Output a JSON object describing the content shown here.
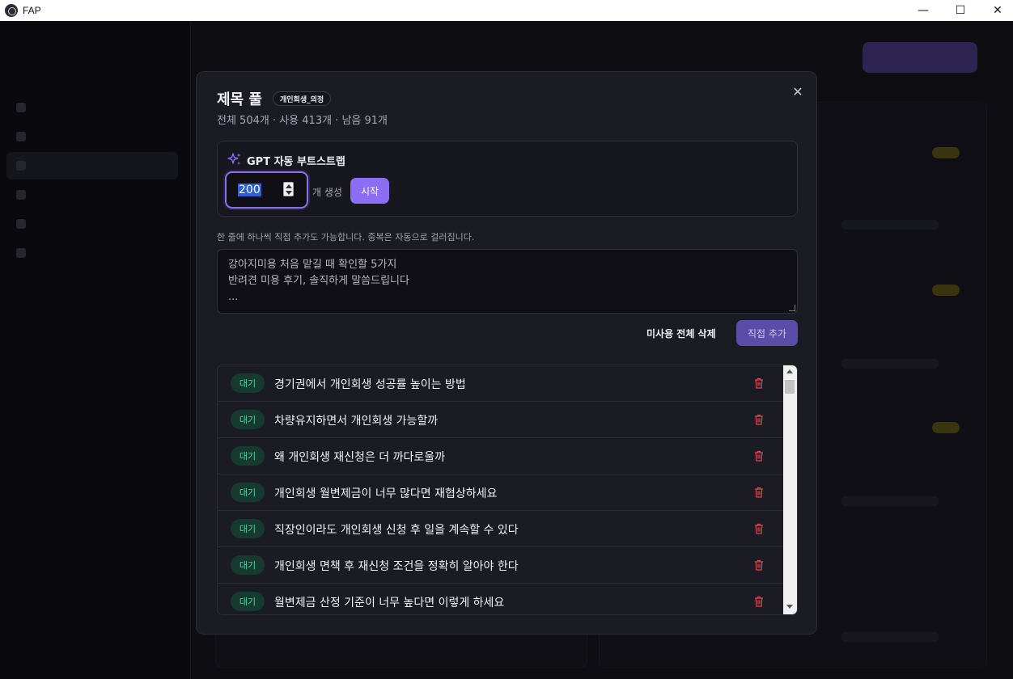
{
  "window": {
    "title": "FAP",
    "minimize": "—",
    "maximize": "☐",
    "close": "✕"
  },
  "modal": {
    "title": "제목 풀",
    "badge": "개인회생_의정",
    "stats": "전체 504개 · 사용 413개 · 남음 91개",
    "close_icon": "✕",
    "gpt": {
      "icon": "sparkles-icon",
      "title": "GPT 자동 부트스트랩",
      "count_value": "200",
      "count_unit": "개 생성",
      "start_label": "시작"
    },
    "helper_text": "한 줄에 하나씩 직접 추가도 가능합니다. 중복은 자동으로 걸러집니다.",
    "textarea_placeholder_lines": [
      "강아지미용 처음 맡길 때 확인할 5가지",
      "반려견 미용 후기, 솔직하게 말씀드립니다",
      "..."
    ],
    "delete_unused_label": "미사용 전체 삭제",
    "add_direct_label": "직접 추가",
    "items": [
      {
        "status": "대기",
        "title": "경기권에서 개인회생 성공률 높이는 방법"
      },
      {
        "status": "대기",
        "title": "차량유지하면서 개인회생 가능할까"
      },
      {
        "status": "대기",
        "title": "왜 개인회생 재신청은 더 까다로울까"
      },
      {
        "status": "대기",
        "title": "개인회생 월변제금이 너무 많다면 재협상하세요"
      },
      {
        "status": "대기",
        "title": "직장인이라도 개인회생 신청 후 일을 계속할 수 있다"
      },
      {
        "status": "대기",
        "title": "개인회생 면책 후 재신청 조건을 정확히 알아야 한다"
      },
      {
        "status": "대기",
        "title": "월변제금 산정 기준이 너무 높다면 이렇게 하세요"
      }
    ]
  },
  "colors": {
    "accent": "#8b6ef2",
    "status_bg": "#163a30",
    "status_fg": "#4fd6a0",
    "danger": "#e0454f"
  }
}
